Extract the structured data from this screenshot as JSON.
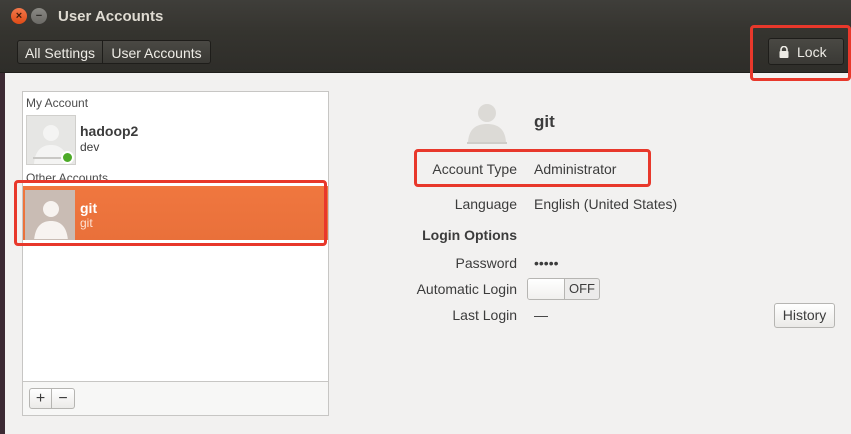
{
  "window": {
    "title": "User Accounts"
  },
  "toolbar": {
    "breadcrumbs": [
      "All Settings",
      "User Accounts"
    ],
    "lock_label": "Lock"
  },
  "sidebar": {
    "my_account_label": "My Account",
    "other_accounts_label": "Other Accounts",
    "users": [
      {
        "name": "hadoop2",
        "subtitle": "dev",
        "online": true,
        "selected": false
      },
      {
        "name": "git",
        "subtitle": "git",
        "online": false,
        "selected": true
      }
    ],
    "add_label": "+",
    "remove_label": "−"
  },
  "details": {
    "name": "git",
    "account_type_label": "Account Type",
    "account_type": "Administrator",
    "language_label": "Language",
    "language": "English (United States)",
    "login_options_label": "Login Options",
    "password_label": "Password",
    "password": "•••••",
    "auto_login_label": "Automatic Login",
    "auto_login": "OFF",
    "last_login_label": "Last Login",
    "last_login": "—",
    "history_label": "History"
  },
  "colors": {
    "selection": "#f0773f",
    "highlight": "#e8382b",
    "online": "#4caa27"
  }
}
